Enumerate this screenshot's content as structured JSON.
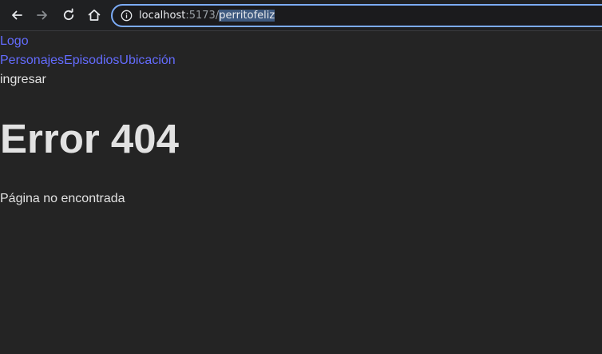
{
  "browser": {
    "url_host": "localhost",
    "url_port": ":5173/",
    "url_path": "perritofeliz"
  },
  "header": {
    "logo": "Logo",
    "nav": {
      "characters": "Personajes",
      "episodes": "Episodios",
      "locations": "Ubicación"
    },
    "login": "ingresar"
  },
  "main": {
    "title": "Error 404",
    "message": "Página no encontrada"
  },
  "colors": {
    "link": "#646cff",
    "background": "#242424",
    "url_focus": "#7cacf8"
  }
}
